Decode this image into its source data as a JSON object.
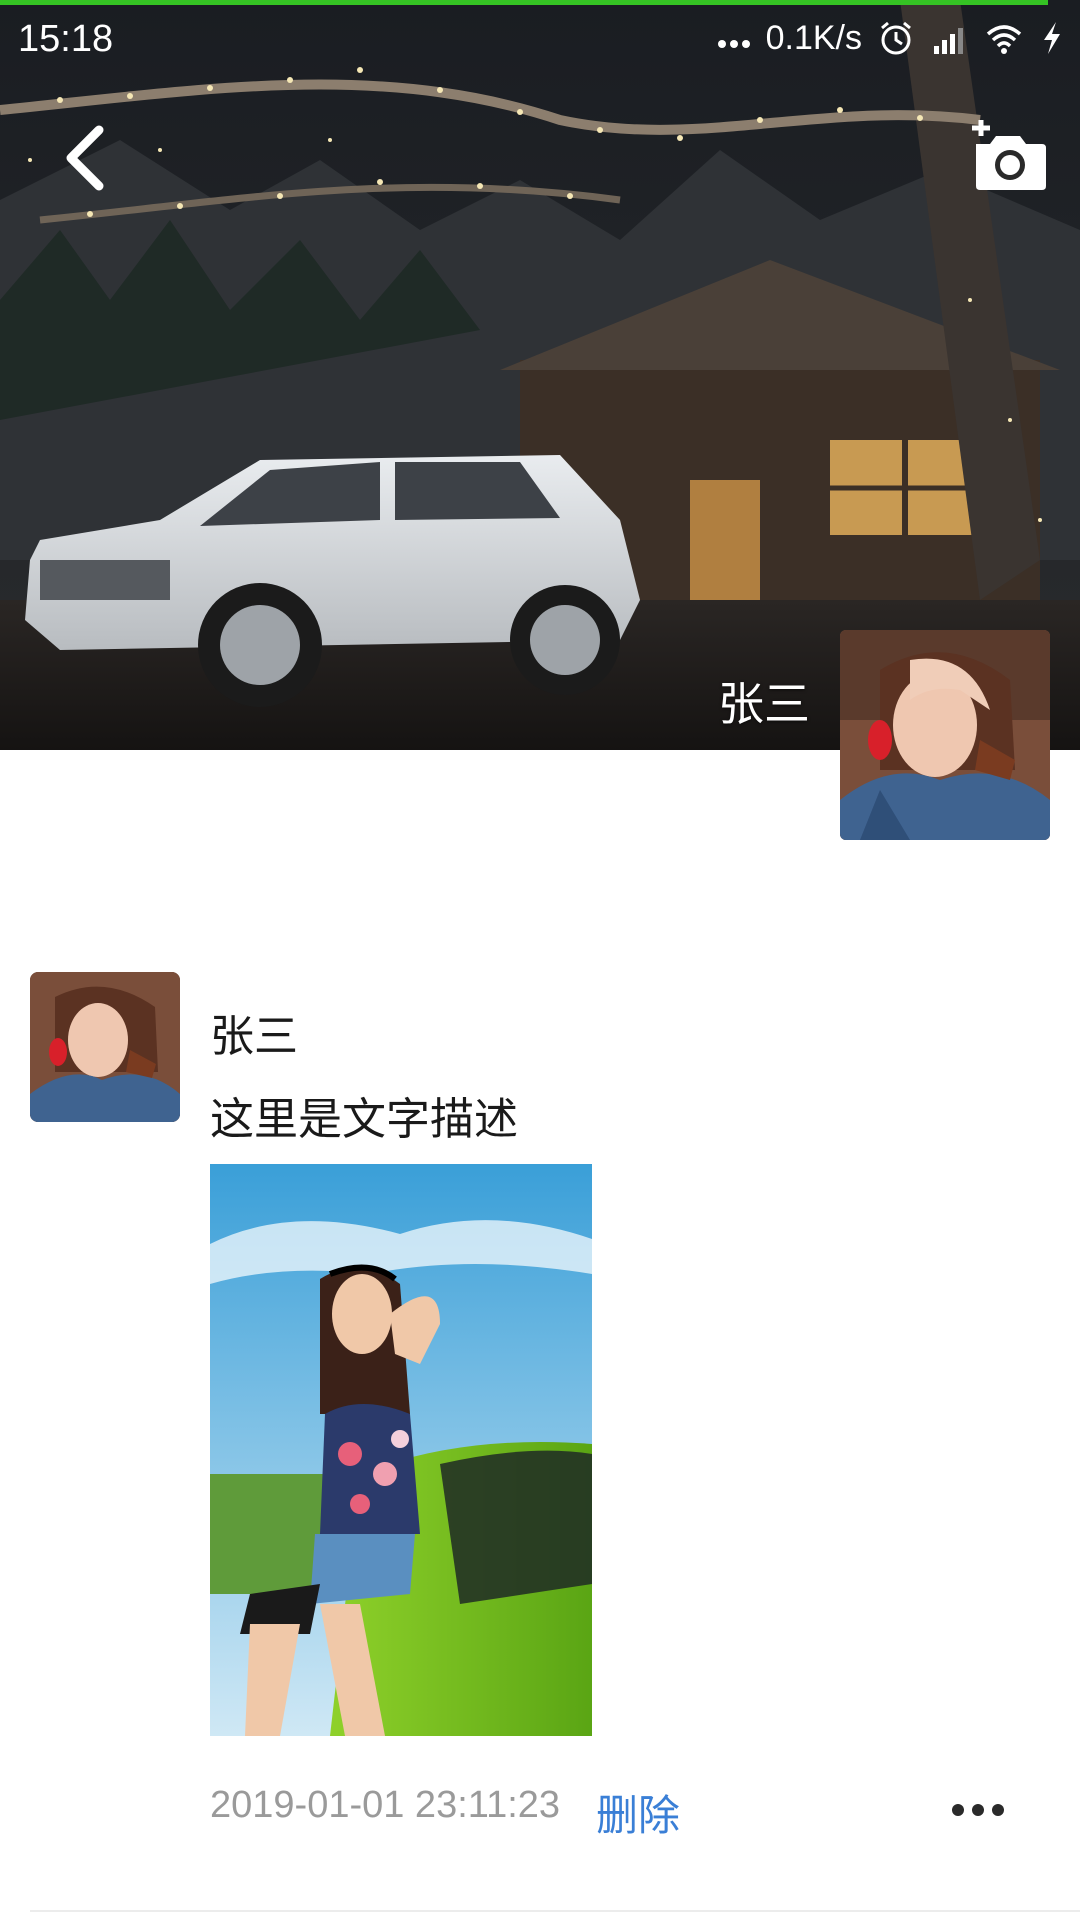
{
  "status_bar": {
    "time": "15:18",
    "network_speed": "0.1K/s",
    "icons": [
      "more-dots-icon",
      "alarm-icon",
      "signal-icon",
      "wifi-icon",
      "charging-icon"
    ]
  },
  "header": {
    "back_icon": "chevron-left-icon",
    "camera_icon": "camera-add-icon",
    "cover_image": "cover-photo",
    "profile_name": "张三",
    "accent_color": "#35c324"
  },
  "feed": {
    "posts": [
      {
        "author": "张三",
        "text": "这里是文字描述",
        "image": "post-photo",
        "timestamp": "2019-01-01 23:11:23",
        "delete_label": "删除",
        "more_icon": "more-dots-icon"
      }
    ]
  },
  "colors": {
    "link": "#3a7fd6",
    "timestamp": "#9a9a9a"
  }
}
